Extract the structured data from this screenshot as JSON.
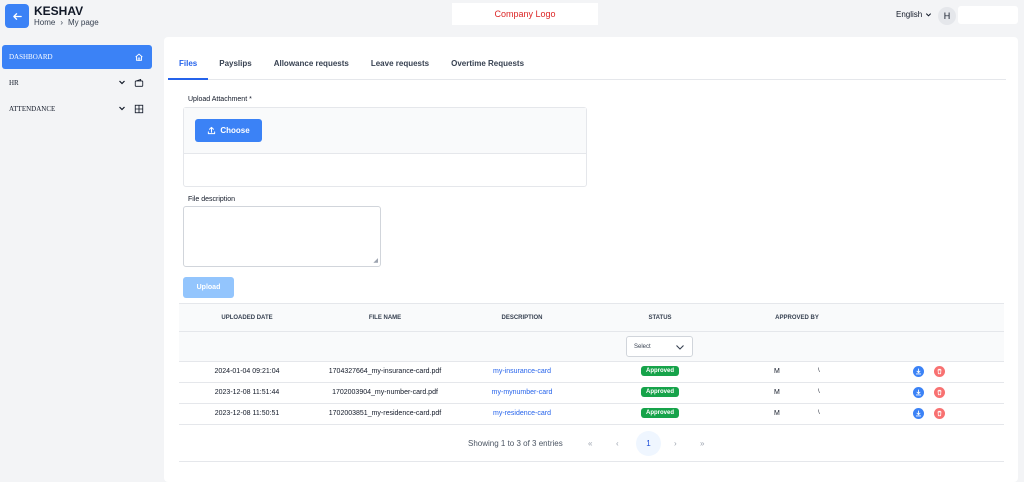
{
  "header": {
    "app_title": "KESHAV",
    "breadcrumb": [
      "Home",
      "My page"
    ],
    "logo_text": "Company Logo",
    "language": "English",
    "avatar_initial": "H"
  },
  "sidebar": {
    "items": [
      {
        "label": "DASHBOARD",
        "icon": "home-icon",
        "active": true
      },
      {
        "label": "HR",
        "icon": "wallet-icon",
        "active": false
      },
      {
        "label": "ATTENDANCE",
        "icon": "grid-icon",
        "active": false
      }
    ]
  },
  "tabs": [
    "Files",
    "Payslips",
    "Allowance requests",
    "Leave requests",
    "Overtime Requests"
  ],
  "form": {
    "upload_label": "Upload Attachment *",
    "choose_label": "Choose",
    "description_label": "File description",
    "upload_button": "Upload"
  },
  "table": {
    "columns": [
      "UPLOADED DATE",
      "FILE NAME",
      "DESCRIPTION",
      "STATUS",
      "APPROVED BY"
    ],
    "status_filter_placeholder": "Select",
    "rows": [
      {
        "date": "2024-01-04 09:21:04",
        "file": "1704327664_my-insurance-card.pdf",
        "description": "my-insurance-card",
        "status": "Approved",
        "approver_a": "M",
        "approver_b": "\\"
      },
      {
        "date": "2023-12-08 11:51:44",
        "file": "1702003904_my-number-card.pdf",
        "description": "my-mynumber-card",
        "status": "Approved",
        "approver_a": "M",
        "approver_b": "\\"
      },
      {
        "date": "2023-12-08 11:50:51",
        "file": "1702003851_my-residence-card.pdf",
        "description": "my-residence-card",
        "status": "Approved",
        "approver_a": "M",
        "approver_b": "\\"
      }
    ]
  },
  "pagination": {
    "showing_text": "Showing 1 to 3 of 3 entries",
    "first": "«",
    "prev": "‹",
    "current_page": "1",
    "next": "›",
    "last": "»"
  },
  "colors": {
    "primary": "#3b82f6",
    "approved": "#16a34a",
    "delete": "#f87171",
    "logo_text": "#dc2626"
  }
}
